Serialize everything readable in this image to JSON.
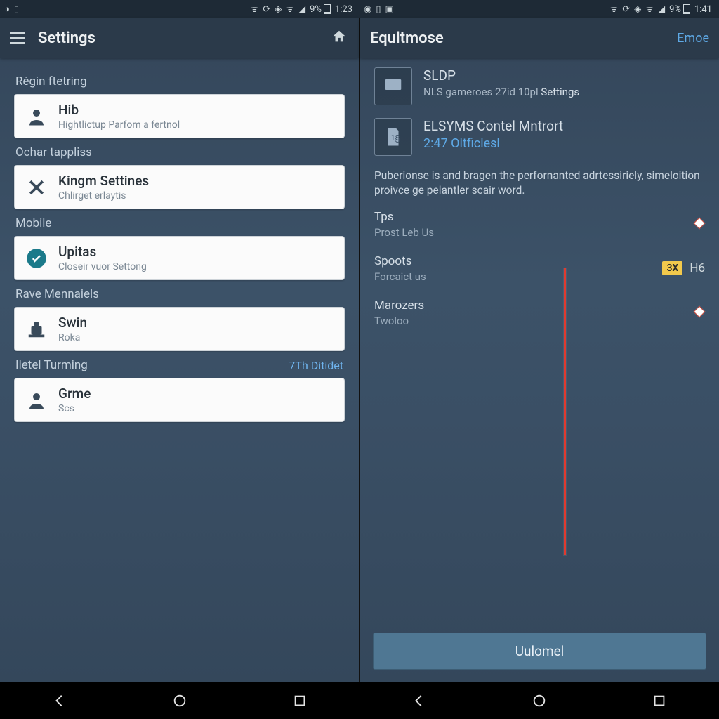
{
  "status_left": {
    "battery_pct": "9%",
    "time": "1:23"
  },
  "status_right": {
    "battery_pct": "9%",
    "time": "1:41"
  },
  "left": {
    "appbar_title": "Settings",
    "sections": {
      "s0": {
        "label": "Rėgin ftetring",
        "card": {
          "title": "Hib",
          "sub": "Hightlictup Parfom a fertnol"
        }
      },
      "s1": {
        "label": "Ochar tappliss",
        "card": {
          "title": "Kingm Settines",
          "sub": "Chlirget erlaytis"
        }
      },
      "s2": {
        "label": "Mobile",
        "card": {
          "title": "Upitas",
          "sub": "Closeir vuor Settong"
        }
      },
      "s3": {
        "label": "Rave Mennaiels",
        "card": {
          "title": "Swin",
          "sub": "Roka"
        }
      },
      "s4": {
        "label": "Iletel Turming",
        "right": "7Th Ditidet",
        "card": {
          "title": "Grme",
          "sub": "Scs"
        }
      }
    }
  },
  "right": {
    "appbar_title": "Equltmose",
    "appbar_link": "Emoe",
    "item0": {
      "t1": "SLDP",
      "t2a": "NLS gameroes 27id 10pl",
      "t2b": "Settings"
    },
    "item1": {
      "t1": "ELSYMS Contel Mntrort",
      "link": "2:47 Oitficiesl"
    },
    "paragraph": "Puberionse is and bragen the perfornanted adrtessiriely, simeloition proivce ge pelantler scair word.",
    "rows": {
      "r0": {
        "l1": "Tps",
        "l2": "Prost Leb Us"
      },
      "r1": {
        "l1": "Spoots",
        "l2": "Forcaict us",
        "badge": "3X",
        "after": "H6"
      },
      "r2": {
        "l1": "Marozers",
        "l2": "Twoloo"
      }
    },
    "button": "Uulomel"
  }
}
